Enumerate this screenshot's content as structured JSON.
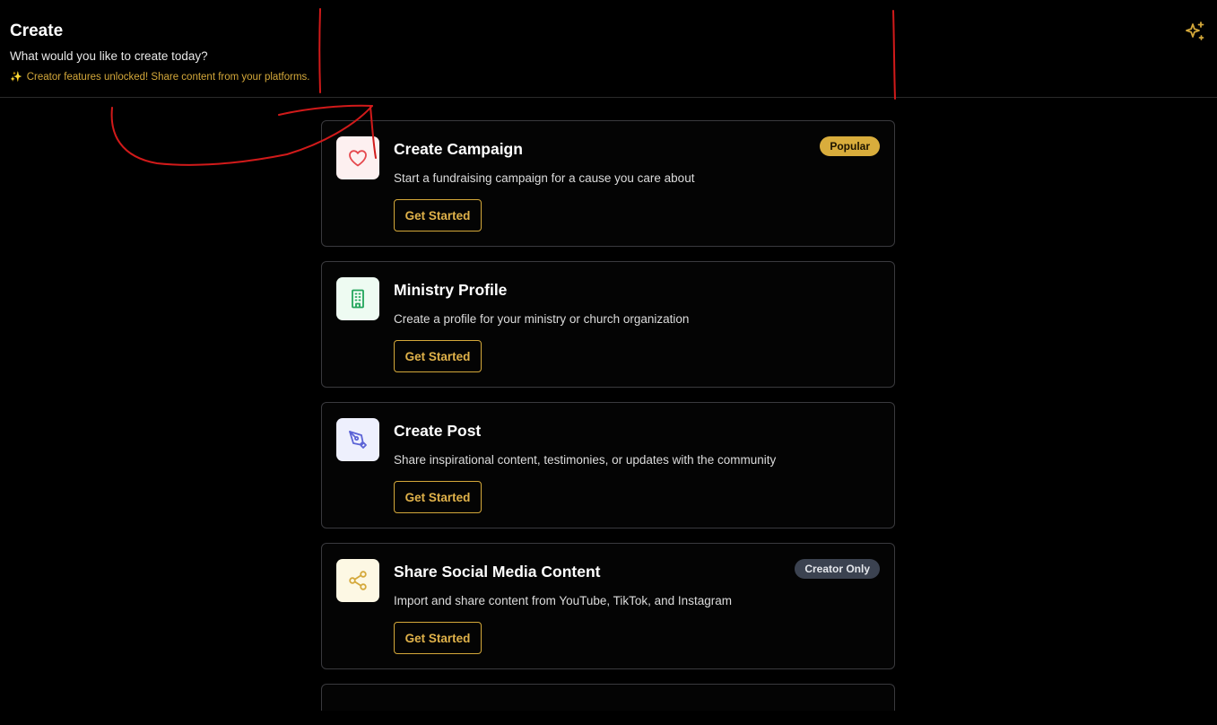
{
  "header": {
    "title": "Create",
    "subtitle": "What would you like to create today?",
    "unlock_note": "Creator features unlocked! Share content from your platforms.",
    "sparkle_icon": "sparkles-icon",
    "accent_color": "#d4a83a"
  },
  "cards": [
    {
      "title": "Create Campaign",
      "description": "Start a fundraising campaign for a cause you care about",
      "button": "Get Started",
      "badge": "Popular",
      "icon": "heart-icon",
      "icon_bg": "#fdf0f0",
      "icon_color": "#e5484d"
    },
    {
      "title": "Ministry Profile",
      "description": "Create a profile for your ministry or church organization",
      "button": "Get Started",
      "icon": "building-icon",
      "icon_bg": "#eefbf2",
      "icon_color": "#22a55b"
    },
    {
      "title": "Create Post",
      "description": "Share inspirational content, testimonies, or updates with the community",
      "button": "Get Started",
      "icon": "pen-tool-icon",
      "icon_bg": "#eef0fd",
      "icon_color": "#5b63d6"
    },
    {
      "title": "Share Social Media Content",
      "description": "Import and share content from YouTube, TikTok, and Instagram",
      "button": "Get Started",
      "badge": "Creator Only",
      "icon": "share-icon",
      "icon_bg": "#fdf8e4",
      "icon_color": "#d4a83a"
    }
  ]
}
